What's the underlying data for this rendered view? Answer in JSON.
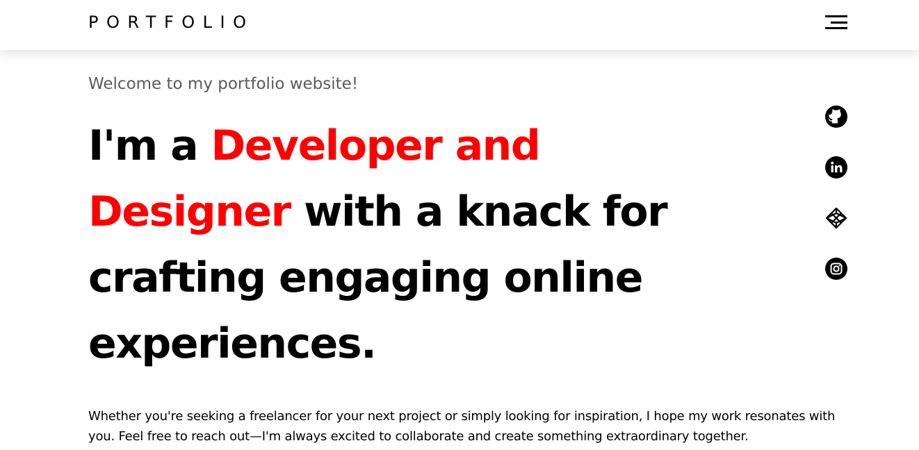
{
  "navbar": {
    "logo": "PORTFOLIO",
    "menu_icon": "hamburger-menu-icon"
  },
  "hero": {
    "welcome": "Welcome to my portfolio website!",
    "headline": {
      "prefix": "I'm a ",
      "accent": "Developer and Designer",
      "suffix": " with a knack for crafting engaging online experiences."
    },
    "intro": "Whether you're seeking a freelancer for your next project or simply looking for inspiration, I hope my work resonates with you. Feel free to reach out—I'm always excited to collaborate and create something extraordinary together."
  },
  "social": [
    {
      "icon": "github-icon"
    },
    {
      "icon": "linkedin-icon"
    },
    {
      "icon": "codepen-icon"
    },
    {
      "icon": "instagram-icon"
    }
  ],
  "colors": {
    "accent": "#ff0000",
    "text": "#000000",
    "muted": "#5b5b5b",
    "background": "#ffffff"
  }
}
